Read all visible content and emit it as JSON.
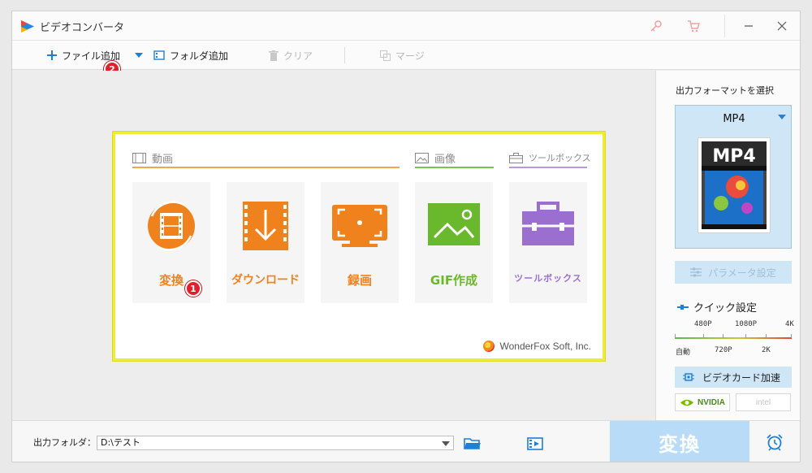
{
  "app": {
    "title": "ビデオコンバータ"
  },
  "toolbar": {
    "add_file": "ファイル追加",
    "add_folder": "フォルダ追加",
    "clear": "クリア",
    "merge": "マージ"
  },
  "badges": {
    "one": "1",
    "two": "2"
  },
  "categories": {
    "video": "動画",
    "image": "画像",
    "toolbox": "ツールボックス"
  },
  "cards": {
    "convert": "変換",
    "download": "ダウンロード",
    "record": "録画",
    "gif": "GIF作成",
    "toolbox": "ツールボックス"
  },
  "brand": "WonderFox Soft, Inc.",
  "side": {
    "title": "出力フォーマットを選択",
    "format": "MP4",
    "format_thumb": "MP4",
    "params": "パラメータ設定",
    "quick": "クイック設定",
    "q_top": [
      "480P",
      "1080P",
      "4K"
    ],
    "q_bottom": [
      "自動",
      "720P",
      "2K"
    ],
    "gpu": "ビデオカード加速",
    "nvidia": "NVIDIA",
    "intel": "intel"
  },
  "bottom": {
    "output_label": "出力フォルダ：",
    "output_path": "D:\\テスト",
    "convert": "変換"
  },
  "colors": {
    "accent_orange": "#f0821e",
    "accent_green": "#6ab82c",
    "accent_purple": "#9b6fd0",
    "highlight": "#f0ec33",
    "convert_btn": "#b8dcf8"
  }
}
